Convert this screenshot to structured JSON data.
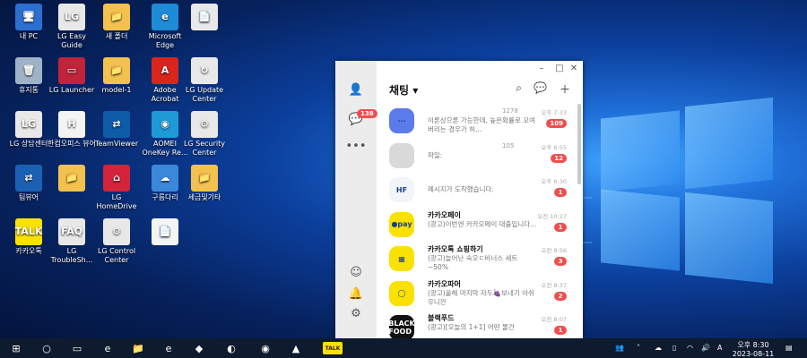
{
  "desktop": {
    "icons": [
      {
        "label": "내 PC",
        "glyph": "🖥",
        "bg": "#2b6fd1"
      },
      {
        "label": "LG Easy Guide",
        "glyph": "LG",
        "bg": "#e8e8e8"
      },
      {
        "label": "새 폴더",
        "glyph": "📁",
        "bg": "#f2c14e"
      },
      {
        "label": "Microsoft Edge",
        "glyph": "e",
        "bg": "#1f8bd6"
      },
      {
        "label": "",
        "glyph": "📄",
        "bg": "#e9e9e9"
      },
      {
        "label": "휴지통",
        "glyph": "🗑",
        "bg": "#9fb3c8"
      },
      {
        "label": "LG Launcher",
        "glyph": "▭",
        "bg": "#c0233a"
      },
      {
        "label": "model-1",
        "glyph": "📁",
        "bg": "#f2c14e"
      },
      {
        "label": "Adobe Acrobat",
        "glyph": "A",
        "bg": "#d9251c"
      },
      {
        "label": "LG Update Center",
        "glyph": "↻",
        "bg": "#e8e8e8"
      },
      {
        "label": "LG 상담센터",
        "glyph": "LG",
        "bg": "#e8e8e8"
      },
      {
        "label": "한컴오피스 뷰어",
        "glyph": "H",
        "bg": "#f4f4f4"
      },
      {
        "label": "TeamViewer",
        "glyph": "⇄",
        "bg": "#0e5ba8"
      },
      {
        "label": "AOMEI OneKey Re...",
        "glyph": "◉",
        "bg": "#1e9ad6"
      },
      {
        "label": "LG Security Center",
        "glyph": "⚙",
        "bg": "#e8e8e8"
      },
      {
        "label": "팀뷰어",
        "glyph": "⇄",
        "bg": "#1b61b3"
      },
      {
        "label": "",
        "glyph": "📁",
        "bg": "#f2c14e"
      },
      {
        "label": "LG HomeDrive",
        "glyph": "⌂",
        "bg": "#d3243b"
      },
      {
        "label": "구름다리",
        "glyph": "☁",
        "bg": "#3b87d9"
      },
      {
        "label": "세금및기타",
        "glyph": "📁",
        "bg": "#f2c14e"
      },
      {
        "label": "카카오톡",
        "glyph": "TALK",
        "bg": "#fae100"
      },
      {
        "label": "LG TroubleSh...",
        "glyph": "FAQ",
        "bg": "#e8e8e8"
      },
      {
        "label": "LG Control Center",
        "glyph": "⚙",
        "bg": "#e8e8e8"
      },
      {
        "label": "",
        "glyph": "📄",
        "bg": "#f4f4f4"
      }
    ]
  },
  "chat_window": {
    "title": "채팅",
    "side_badge": "138",
    "chats": [
      {
        "name": "",
        "preview": "이론상으론 가능한데, 높은확률로 꼬여버리는 경우가 허...",
        "time": "오후 7:33",
        "unread": "109",
        "avatar_text": "···",
        "avatar_bg": "#5b7bea",
        "extra": "1278"
      },
      {
        "name": "",
        "preview": "파일: ",
        "time": "오후 6:55",
        "unread": "12",
        "avatar_text": "",
        "avatar_bg": "#d9d9d9",
        "extra": "105"
      },
      {
        "name": "",
        "preview": "메시지가 도착했습니다.",
        "time": "오후 6:30",
        "unread": "1",
        "avatar_text": "HF",
        "avatar_bg": "#f2f6fb"
      },
      {
        "name": "카카오페이",
        "preview": "(광고)이번엔 카카오페이 대출입니다...",
        "time": "오전 10:27",
        "unread": "1",
        "avatar_text": "●pay",
        "avatar_bg": "#fae100"
      },
      {
        "name": "카카오톡 쇼핑하기",
        "preview": "(광고)늘어난 숙오ㄷ비너스 세트 ~50%",
        "time": "오전 8:56",
        "unread": "3",
        "avatar_text": "▦",
        "avatar_bg": "#fae100"
      },
      {
        "name": "카카오파머",
        "preview": "(광고)올해 마지막 자두🍇보내기 아쉬우니깐",
        "time": "오전 8:37",
        "unread": "2",
        "avatar_text": "◯",
        "avatar_bg": "#fae100"
      },
      {
        "name": "블랙푸드",
        "preview": "(광고)[오늘의 1+1] 어떤 물건",
        "time": "오전 8:07",
        "unread": "1",
        "avatar_text": "BLACK FOOD",
        "avatar_bg": "#111111"
      }
    ]
  },
  "taskbar": {
    "time": "오후 8:30",
    "date": "2023-08-11",
    "chat_app_badge": "TALK"
  }
}
